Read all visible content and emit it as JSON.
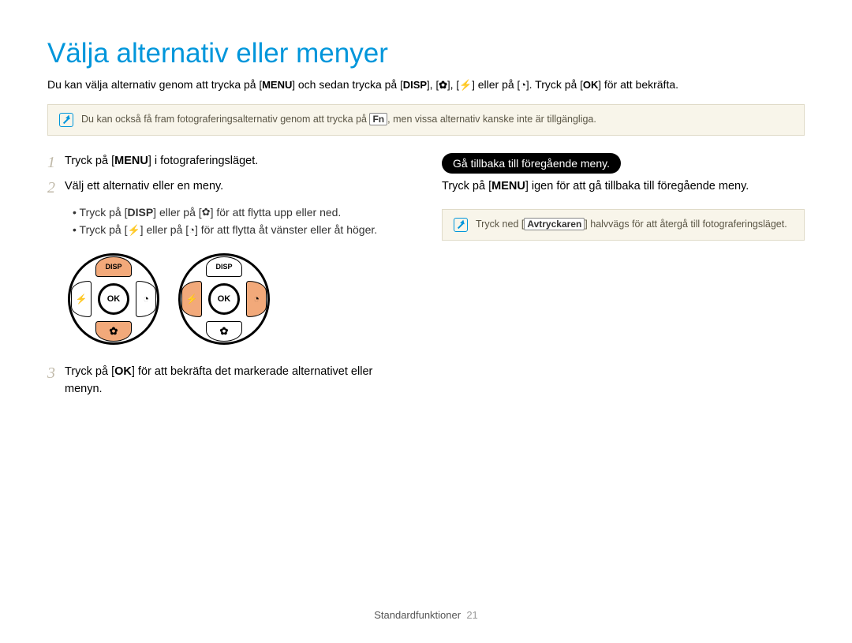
{
  "title": "Välja alternativ eller menyer",
  "intro": {
    "part1": "Du kan välja alternativ genom att trycka på ",
    "menu_label": "MENU",
    "part2": " och sedan trycka på ",
    "disp_label": "DISP",
    "flower_label": "✿",
    "bolt_label": "⚡",
    "part3": " eller på ",
    "timer_label": "◔",
    "part4": ". Tryck på ",
    "ok_label": "OK",
    "part5": " för att bekräfta."
  },
  "note1": {
    "part1": "Du kan också få fram fotograferingsalternativ genom att trycka på ",
    "fn_label": "Fn",
    "part2": ", men vissa alternativ kanske inte är tillgängliga."
  },
  "left": {
    "step1": {
      "num": "1",
      "part1": "Tryck på [",
      "menu": "MENU",
      "part2": "] i fotograferingsläget."
    },
    "step2": {
      "num": "2",
      "text": "Välj ett alternativ eller en meny."
    },
    "bullet1": {
      "part1": "Tryck på [",
      "disp": "DISP",
      "part2": "] eller på [",
      "flower": "✿",
      "part3": "] för att flytta upp eller ned."
    },
    "bullet2": {
      "part1": "Tryck på [",
      "bolt": "⚡",
      "part2": "] eller på [",
      "timer": "◔",
      "part3": "] för att flytta åt vänster eller åt höger."
    },
    "step3": {
      "num": "3",
      "part1": "Tryck på [",
      "ok": "OK",
      "part2": "] för att bekräfta det markerade alternativet eller menyn."
    },
    "dpad": {
      "disp": "DISP",
      "ok": "OK"
    }
  },
  "right": {
    "pill": "Gå tillbaka till föregående meny.",
    "line": {
      "part1": "Tryck på [",
      "menu": "MENU",
      "part2": "] igen för att gå tillbaka till föregående meny."
    },
    "note": {
      "part1": "Tryck ned [",
      "shutter": "Avtryckaren",
      "part2": "] halvvägs för att återgå till fotograferingsläget."
    }
  },
  "footer": {
    "label": "Standardfunktioner",
    "page": "21"
  }
}
